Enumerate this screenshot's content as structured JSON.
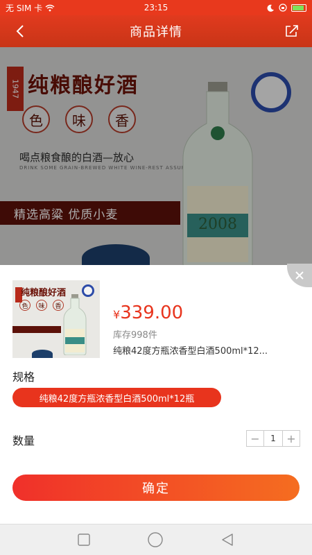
{
  "status_bar": {
    "carrier": "无 SIM 卡",
    "time": "23:15"
  },
  "nav": {
    "title": "商品详情",
    "back_icon": "chevron-left-icon",
    "share_icon": "share-icon"
  },
  "hero": {
    "year": "1947",
    "title": "纯粮酿好酒",
    "circles": [
      "色",
      "味",
      "香"
    ],
    "subtitle": "喝点粮食酿的白酒—放心",
    "subtitle_en": "DRINK SOME GRAIN-BREWED WHITE WINE-REST ASSURED",
    "banner": "精选高粱 优质小麦",
    "label_number": "2008"
  },
  "sheet": {
    "thumb_title": "纯粮酿好酒",
    "thumb_circles": [
      "色",
      "味",
      "香"
    ],
    "currency": "¥",
    "price": "339.00",
    "stock": "库存998件",
    "product_name": "纯粮42度方瓶浓香型白酒500ml*12...",
    "spec_label": "规格",
    "spec_option": "纯粮42度方瓶浓香型白酒500ml*12瓶",
    "qty_label": "数量",
    "qty_minus": "−",
    "qty_value": "1",
    "qty_plus": "+",
    "confirm": "确定"
  },
  "colors": {
    "accent": "#e8341d",
    "nav_bg": "#d5381a",
    "button_start": "#f0302a",
    "button_end": "#f56d20"
  }
}
